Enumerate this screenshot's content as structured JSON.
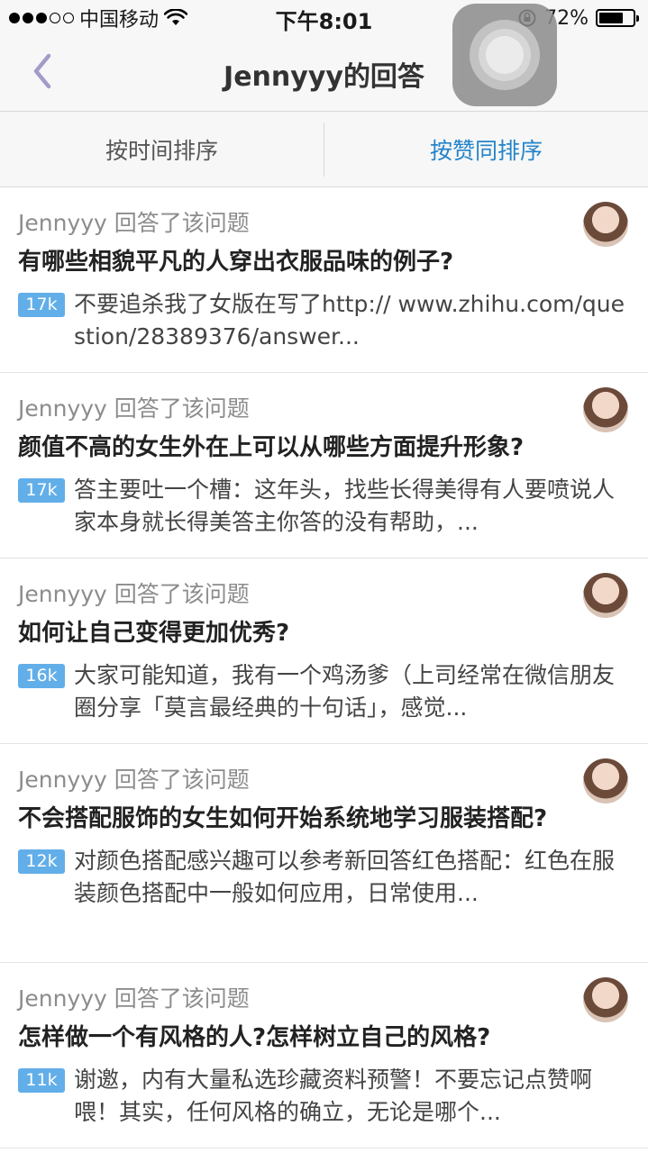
{
  "status_bar": {
    "carrier": "中国移动",
    "time": "下午8:01",
    "battery": "72%",
    "battery_level": 0.72,
    "icons": [
      "signal-dots-icon",
      "wifi-icon",
      "rotation-lock-icon",
      "battery-icon"
    ]
  },
  "nav": {
    "title": "Jennyyy的回答",
    "back_icon": "chevron-left-icon"
  },
  "tabs": [
    {
      "label": "按时间排序",
      "active": false
    },
    {
      "label": "按赞同排序",
      "active": true
    }
  ],
  "answers": [
    {
      "meta": "Jennyyy 回答了该问题",
      "title": "有哪些相貌平凡的人穿出衣服品味的例子?",
      "votes": "17k",
      "excerpt": "不要追杀我了女版在写了http:// www.zhihu.com/question/28389376/answer..."
    },
    {
      "meta": "Jennyyy 回答了该问题",
      "title": "颜值不高的女生外在上可以从哪些方面提升形象?",
      "votes": "17k",
      "excerpt": "答主要吐一个槽：这年头，找些长得美得有人要喷说人家本身就长得美答主你答的没有帮助，..."
    },
    {
      "meta": "Jennyyy 回答了该问题",
      "title": "如何让自己变得更加优秀?",
      "votes": "16k",
      "excerpt": "大家可能知道，我有一个鸡汤爹（上司经常在微信朋友圈分享「莫言最经典的十句话」，感觉..."
    },
    {
      "meta": "Jennyyy 回答了该问题",
      "title": "不会搭配服饰的女生如何开始系统地学习服装搭配?",
      "votes": "12k",
      "excerpt": "对颜色搭配感兴趣可以参考新回答红色搭配：红色在服装颜色搭配中一般如何应用，日常使用..."
    },
    {
      "meta": "Jennyyy 回答了该问题",
      "title": "怎样做一个有风格的人?怎样树立自己的风格?",
      "votes": "11k",
      "excerpt": "谢邀，内有大量私选珍藏资料预警！不要忘记点赞啊喂！其实，任何风格的确立，无论是哪个..."
    }
  ],
  "colors": {
    "accent": "#2484c9",
    "vote_badge": "#62aee9",
    "meta_text": "#8c8c8c",
    "back_arrow": "#a39bc9"
  }
}
